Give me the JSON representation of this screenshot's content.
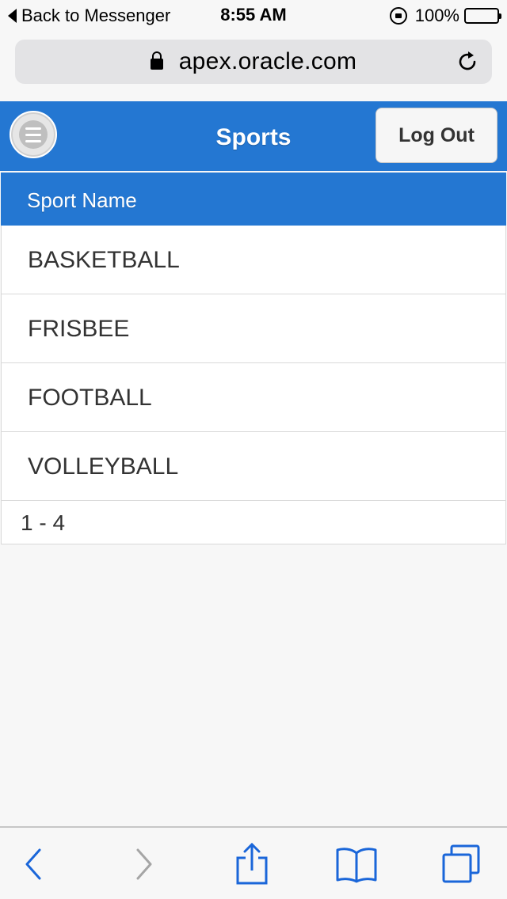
{
  "status_bar": {
    "back_label": "Back to Messenger",
    "time": "8:55 AM",
    "battery": "100%"
  },
  "browser": {
    "url": "apex.oracle.com"
  },
  "app": {
    "title": "Sports",
    "logout_label": "Log Out"
  },
  "report": {
    "column_header": "Sport Name",
    "rows": [
      "BASKETBALL",
      "FRISBEE",
      "FOOTBALL",
      "VOLLEYBALL"
    ],
    "pagination": "1 - 4"
  },
  "colors": {
    "header_blue": "#2477d2",
    "toolbar_blue": "#1a66d9",
    "disabled_gray": "#a5a5a5"
  }
}
